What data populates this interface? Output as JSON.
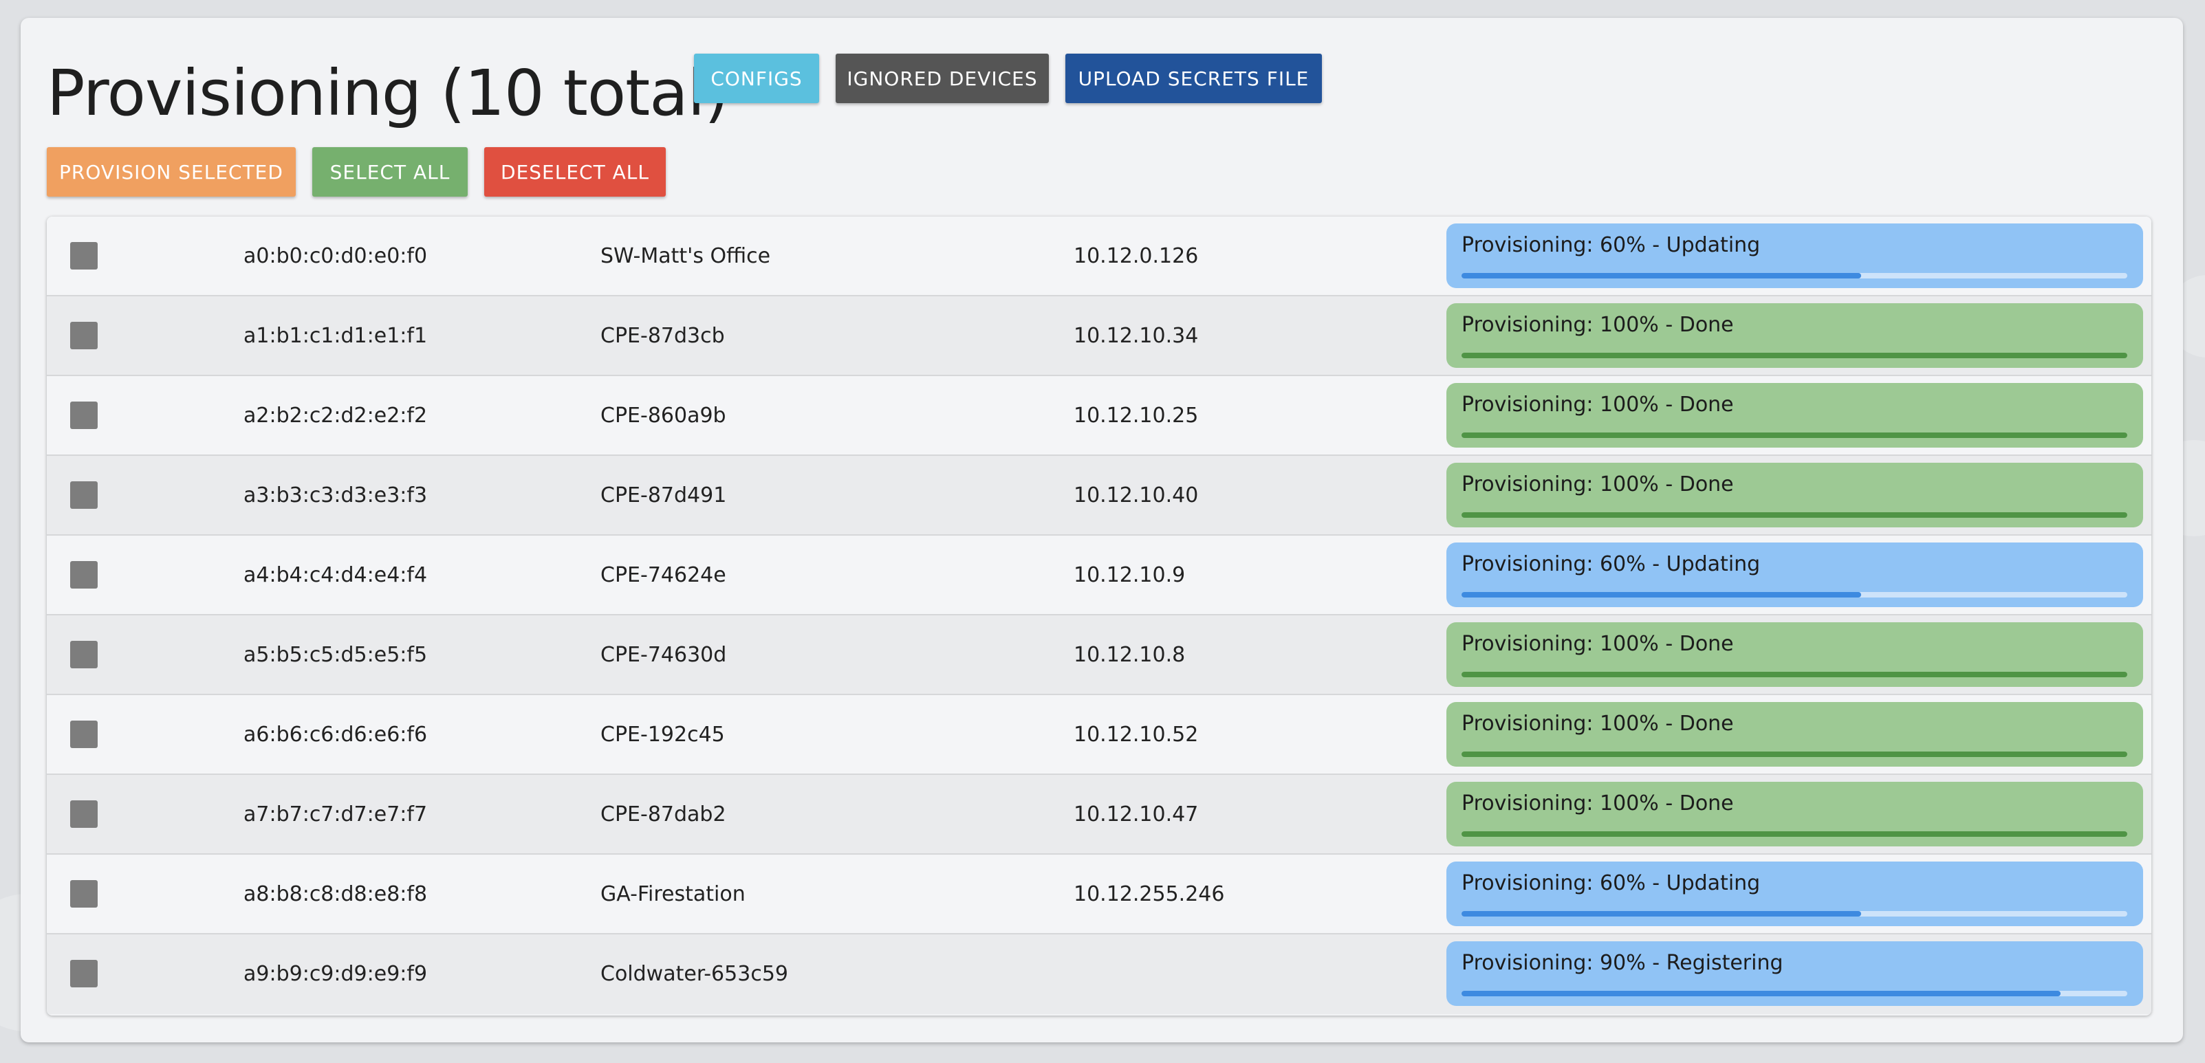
{
  "page": {
    "title": "Provisioning (10 total)"
  },
  "header_buttons": {
    "configs": "CONFIGS",
    "ignored": "IGNORED DEVICES",
    "upload": "UPLOAD SECRETS FILE"
  },
  "action_buttons": {
    "provision": "PROVISION SELECTED",
    "select_all": "SELECT ALL",
    "deselect_all": "DESELECT ALL"
  },
  "colors": {
    "configs": "#5bc0de",
    "ignored": "#555555",
    "upload": "#22539a",
    "provision": "#f0a060",
    "select_all": "#76b06e",
    "deselect_all": "#e05040",
    "status_blue_bg": "#90c3f5",
    "status_blue_bar": "#3d8ae0",
    "status_blue_track": "#cde3fa",
    "status_green_bg": "#9dc994",
    "status_green_bar": "#4f9445",
    "status_green_track": "#c6e2c0"
  },
  "devices": [
    {
      "mac": "a0:b0:c0:d0:e0:f0",
      "name": "SW-Matt's Office",
      "ip": "10.12.0.126",
      "status": "Provisioning: 60% - Updating",
      "progress": 0.6,
      "state": "blue"
    },
    {
      "mac": "a1:b1:c1:d1:e1:f1",
      "name": "CPE-87d3cb",
      "ip": "10.12.10.34",
      "status": "Provisioning: 100% - Done",
      "progress": 1.0,
      "state": "green"
    },
    {
      "mac": "a2:b2:c2:d2:e2:f2",
      "name": "CPE-860a9b",
      "ip": "10.12.10.25",
      "status": "Provisioning: 100% - Done",
      "progress": 1.0,
      "state": "green"
    },
    {
      "mac": "a3:b3:c3:d3:e3:f3",
      "name": "CPE-87d491",
      "ip": "10.12.10.40",
      "status": "Provisioning: 100% - Done",
      "progress": 1.0,
      "state": "green"
    },
    {
      "mac": "a4:b4:c4:d4:e4:f4",
      "name": "CPE-74624e",
      "ip": "10.12.10.9",
      "status": "Provisioning: 60% - Updating",
      "progress": 0.6,
      "state": "blue"
    },
    {
      "mac": "a5:b5:c5:d5:e5:f5",
      "name": "CPE-74630d",
      "ip": "10.12.10.8",
      "status": "Provisioning: 100% - Done",
      "progress": 1.0,
      "state": "green"
    },
    {
      "mac": "a6:b6:c6:d6:e6:f6",
      "name": "CPE-192c45",
      "ip": "10.12.10.52",
      "status": "Provisioning: 100% - Done",
      "progress": 1.0,
      "state": "green"
    },
    {
      "mac": "a7:b7:c7:d7:e7:f7",
      "name": "CPE-87dab2",
      "ip": "10.12.10.47",
      "status": "Provisioning: 100% - Done",
      "progress": 1.0,
      "state": "green"
    },
    {
      "mac": "a8:b8:c8:d8:e8:f8",
      "name": "GA-Firestation",
      "ip": "10.12.255.246",
      "status": "Provisioning: 60% - Updating",
      "progress": 0.6,
      "state": "blue"
    },
    {
      "mac": "a9:b9:c9:d9:e9:f9",
      "name": "Coldwater-653c59",
      "ip": "",
      "status": "Provisioning: 90% - Registering",
      "progress": 0.9,
      "state": "blue"
    }
  ]
}
